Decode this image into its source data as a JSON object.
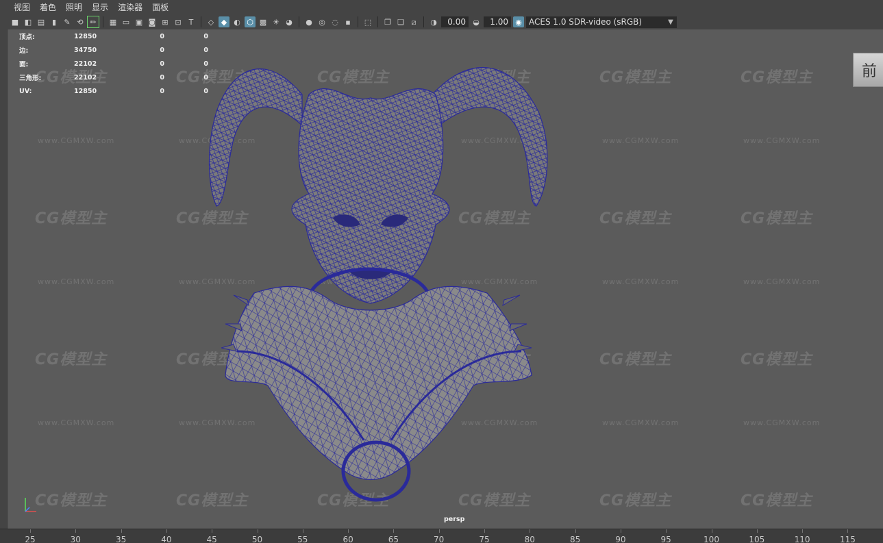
{
  "menu": [
    "视图",
    "着色",
    "照明",
    "显示",
    "渲染器",
    "面板"
  ],
  "toolbar": {
    "exposure_value": "0.00",
    "gamma_value": "1.00",
    "color_space": "ACES 1.0 SDR-video (sRGB)"
  },
  "hud": {
    "rows": [
      {
        "label": "顶点:",
        "v1": "12850",
        "v2": "0",
        "v3": "0"
      },
      {
        "label": "边:",
        "v1": "34750",
        "v2": "0",
        "v3": "0"
      },
      {
        "label": "面:",
        "v1": "22102",
        "v2": "0",
        "v3": "0"
      },
      {
        "label": "三角形:",
        "v1": "22102",
        "v2": "0",
        "v3": "0"
      },
      {
        "label": "UV:",
        "v1": "12850",
        "v2": "0",
        "v3": "0"
      }
    ]
  },
  "viewcube_label": "前",
  "camera_label": "persp",
  "watermark": {
    "logo": "CG模型主",
    "url": "www.CGMXW.com"
  },
  "timeline": {
    "ticks": [
      "25",
      "30",
      "35",
      "40",
      "45",
      "50",
      "55",
      "60",
      "65",
      "70",
      "75",
      "80",
      "85",
      "90",
      "95",
      "100",
      "105",
      "110",
      "115"
    ]
  },
  "colors": {
    "wireframe": "#2a2a9a",
    "mesh_fill": "#7a7a7a",
    "viewport_bg": "#5b5b5b"
  }
}
